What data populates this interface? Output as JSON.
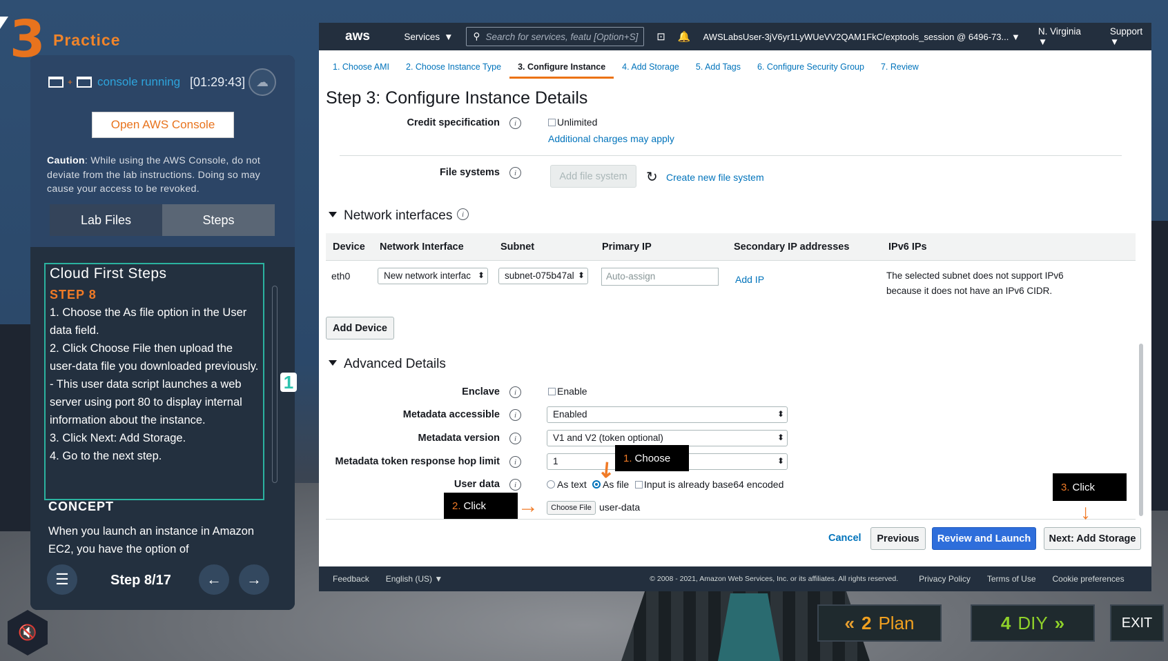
{
  "practice": {
    "number": "3",
    "label": "Practice"
  },
  "console": {
    "status": "console running",
    "timer": "[01:29:43]",
    "open_button": "Open AWS Console",
    "caution_bold": "Caution",
    "caution_text": ": While using the AWS Console, do not deviate from the lab instructions. Doing so may cause your access to be revoked."
  },
  "panel_tabs": [
    {
      "label": "Lab Files"
    },
    {
      "label": "Steps"
    }
  ],
  "steps": {
    "title": "Cloud First Steps",
    "step_label": "STEP 8",
    "lines": [
      "1. Choose the As file option in the User data field.",
      "2. Click Choose File then upload the user-data file you downloaded previously.",
      "- This user data script launches a web server using port 80 to display internal information about the instance.",
      "3. Click Next: Add Storage.",
      "4. Go to the next step."
    ],
    "badge": "1",
    "concept_title": "CONCEPT",
    "concept_text": "When you launch an instance in Amazon EC2, you have the option of",
    "step_counter": "Step 8/17"
  },
  "aws_nav": {
    "logo": "aws",
    "services": "Services",
    "search_placeholder": "Search for services, featu [Option+S]",
    "account": "AWSLabsUser-3jV6yr1LyWUeVV2QAM1FkC/exptools_session @ 6496-73...",
    "region": "N. Virginia",
    "support": "Support"
  },
  "wizard_tabs": [
    "1. Choose AMI",
    "2. Choose Instance Type",
    "3. Configure Instance",
    "4. Add Storage",
    "5. Add Tags",
    "6. Configure Security Group",
    "7. Review"
  ],
  "page_title": "Step 3: Configure Instance Details",
  "credit": {
    "label": "Credit specification",
    "option": "Unlimited",
    "note": "Additional charges may apply"
  },
  "filesystems": {
    "label": "File systems",
    "add_button": "Add file system",
    "create_link": "Create new file system"
  },
  "network": {
    "section": "Network interfaces",
    "headers": [
      "Device",
      "Network Interface",
      "Subnet",
      "Primary IP",
      "Secondary IP addresses",
      "IPv6 IPs"
    ],
    "row": {
      "device": "eth0",
      "interface": "New network interfac",
      "subnet": "subnet-075b47al",
      "primary_ip_placeholder": "Auto-assign",
      "add_ip": "Add IP",
      "ipv6_line1": "The selected subnet does not support IPv6",
      "ipv6_line2": "because it does not have an IPv6 CIDR."
    },
    "add_device": "Add Device"
  },
  "advanced": {
    "section": "Advanced Details",
    "enclave_label": "Enclave",
    "enclave_option": "Enable",
    "metadata_accessible_label": "Metadata accessible",
    "metadata_accessible_value": "Enabled",
    "metadata_version_label": "Metadata version",
    "metadata_version_value": "V1 and V2 (token optional)",
    "hop_limit_label": "Metadata token response hop limit",
    "hop_limit_value": "1",
    "user_data_label": "User data",
    "as_text": "As text",
    "as_file": "As file",
    "base64": "Input is already base64 encoded",
    "choose_file": "Choose File",
    "file_name": "user-data"
  },
  "annotations": [
    {
      "num": "1.",
      "text": "Choose"
    },
    {
      "num": "2.",
      "text": "Click"
    },
    {
      "num": "3.",
      "text": "Click"
    }
  ],
  "actions": {
    "cancel": "Cancel",
    "previous": "Previous",
    "review_launch": "Review and Launch",
    "next": "Next: Add Storage"
  },
  "footer": {
    "feedback": "Feedback",
    "language": "English (US)",
    "copyright": "© 2008 - 2021, Amazon Web Services, Inc. or its affiliates. All rights reserved.",
    "privacy": "Privacy Policy",
    "terms": "Terms of Use",
    "cookies": "Cookie preferences"
  },
  "bottom_nav": {
    "plan_num": "2",
    "plan": "Plan",
    "diy_num": "4",
    "diy": "DIY",
    "exit": "EXIT"
  },
  "colors": {
    "orange": "#f07a26",
    "teal": "#2bb3a0",
    "aws_dark": "#232f3e",
    "aws_link": "#0073bb",
    "primary_button": "#2e6edb"
  }
}
